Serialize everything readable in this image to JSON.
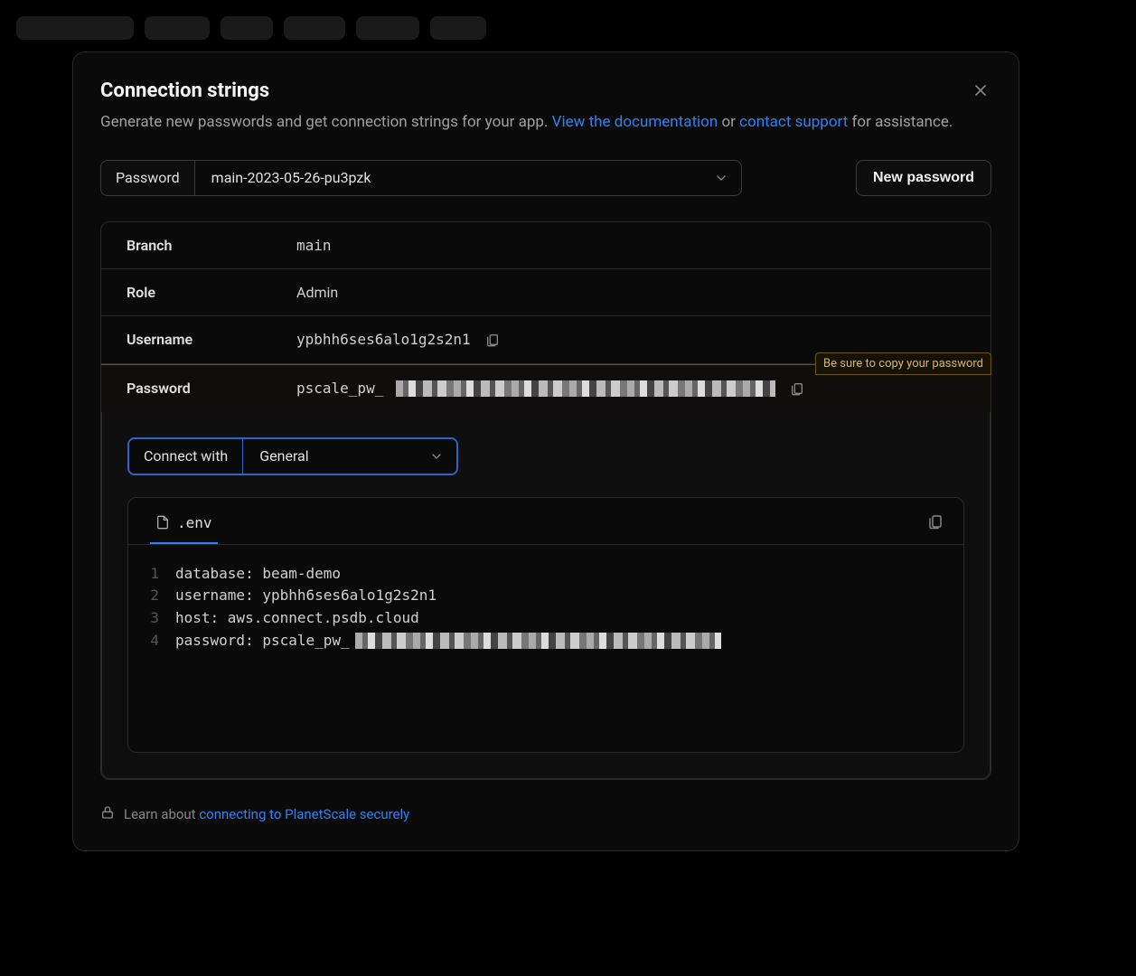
{
  "modal": {
    "title": "Connection strings",
    "subtitle_pre": "Generate new passwords and get connection strings for your app. ",
    "doc_link": "View the documentation",
    "subtitle_mid": " or ",
    "support_link": "contact support",
    "subtitle_post": " for assistance."
  },
  "password_select": {
    "label": "Password",
    "value": "main-2023-05-26-pu3pzk"
  },
  "new_password_btn": "New password",
  "details": {
    "branch_label": "Branch",
    "branch_value": "main",
    "role_label": "Role",
    "role_value": "Admin",
    "username_label": "Username",
    "username_value": "ypbhh6ses6alo1g2s2n1",
    "password_label": "Password",
    "password_prefix": "pscale_pw_",
    "copy_note": "Be sure to copy your password"
  },
  "connect": {
    "label": "Connect with",
    "value": "General"
  },
  "code": {
    "tab": ".env",
    "lines": [
      {
        "n": "1",
        "text": "database: beam-demo"
      },
      {
        "n": "2",
        "text": "username: ypbhh6ses6alo1g2s2n1"
      },
      {
        "n": "3",
        "text": "host: aws.connect.psdb.cloud"
      },
      {
        "n": "4",
        "text": "password: pscale_pw_"
      }
    ]
  },
  "footer": {
    "pre": "Learn about ",
    "link": "connecting to PlanetScale securely"
  }
}
